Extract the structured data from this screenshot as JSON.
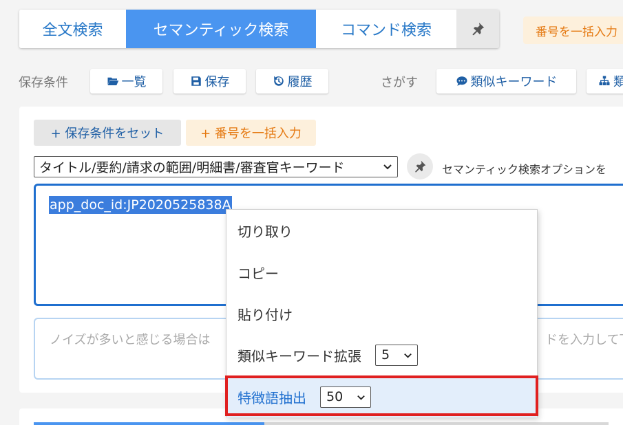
{
  "tabs": {
    "fulltext": "全文検索",
    "semantic": "セマンティック検索",
    "command": "コマンド検索"
  },
  "top_bulk_button": "番号を一括入力",
  "saved_conditions": {
    "label": "保存条件",
    "list_button": "一覧",
    "save_button": "保存",
    "history_button": "履歴"
  },
  "search_tools": {
    "label": "さがす",
    "similar_keywords_button": "類似キーワード",
    "next_button_partial": "類"
  },
  "panel": {
    "set_condition_button": "+ 保存条件をセット",
    "bulk_input_button": "+ 番号を一括入力",
    "field_select_value": "タイトル/要約/請求の範囲/明細書/審査官キーワード",
    "semantic_option_label": "セマンティック検索オプションを",
    "query_text": "app_doc_id:JP2020525838A",
    "noise_placeholder_left": "ノイズが多いと感じる場合は",
    "noise_placeholder_right": "ドを入力して下"
  },
  "context_menu": {
    "items": [
      {
        "label": "切り取り"
      },
      {
        "label": "コピー"
      },
      {
        "label": "貼り付け"
      },
      {
        "label": "類似キーワード拡張",
        "select_value": "5"
      },
      {
        "label": "特徴語抽出",
        "select_value": "50"
      }
    ]
  },
  "colors": {
    "accent_blue": "#4a95f0",
    "link_blue": "#1f5fa5",
    "orange": "#e57a13",
    "highlight_red": "#e02020"
  }
}
